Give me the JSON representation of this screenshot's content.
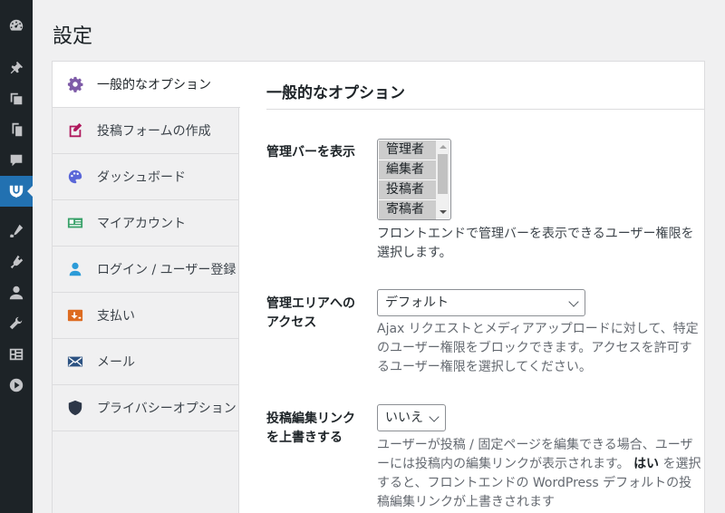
{
  "page": {
    "title": "設定"
  },
  "adminbar": {
    "icons": [
      "dashboard-icon",
      "pin-icon",
      "media-icon",
      "pages-icon",
      "comments-icon",
      "plugin-logo-icon",
      "appearance-icon",
      "plugins-icon",
      "users-icon",
      "tools-icon",
      "settings-icon",
      "play-icon"
    ]
  },
  "tabs": [
    {
      "label": "一般的なオプション",
      "icon": "gear-icon",
      "color": "#7e5ba8",
      "active": true
    },
    {
      "label": "投稿フォームの作成",
      "icon": "edit-post-icon",
      "color": "#b0185d"
    },
    {
      "label": "ダッシュボード",
      "icon": "palette-icon",
      "color": "#5a67d8"
    },
    {
      "label": "マイアカウント",
      "icon": "id-card-icon",
      "color": "#38a169"
    },
    {
      "label": "ログイン / ユーザー登録",
      "icon": "user-icon",
      "color": "#2b9bd8"
    },
    {
      "label": "支払い",
      "icon": "payment-icon",
      "color": "#dd6b20"
    },
    {
      "label": "メール",
      "icon": "mail-icon",
      "color": "#2c5282"
    },
    {
      "label": "プライバシーオプション",
      "icon": "shield-icon",
      "color": "#2d3748"
    }
  ],
  "section": {
    "title": "一般的なオプション",
    "fields": {
      "admin_bar": {
        "label": "管理バーを表示",
        "options": [
          "管理者",
          "編集者",
          "投稿者",
          "寄稿者"
        ],
        "description": "フロントエンドで管理バーを表示できるユーザー権限を選択します。"
      },
      "admin_access": {
        "label_line1": "管理エリアへの",
        "label_line2": "アクセス",
        "value": "デフォルト",
        "description": "Ajax リクエストとメディアアップロードに対して、特定のユーザー権限をブロックできます。アクセスを許可するユーザー権限を選択してください。"
      },
      "override_edit_link": {
        "label_line1": "投稿編集リンク",
        "label_line2": "を上書きする",
        "value": "いいえ",
        "description_pre": "ユーザーが投稿 / 固定ページを編集できる場合、ユーザーには投稿内の編集リンクが表示されます。",
        "description_bold": "はい",
        "description_post": "を選択すると、フロントエンドの WordPress デフォルトの投稿編集リンクが上書きされます"
      }
    }
  },
  "colors": {
    "accent": "#2271b1",
    "adminbar_bg": "#1d2327"
  }
}
